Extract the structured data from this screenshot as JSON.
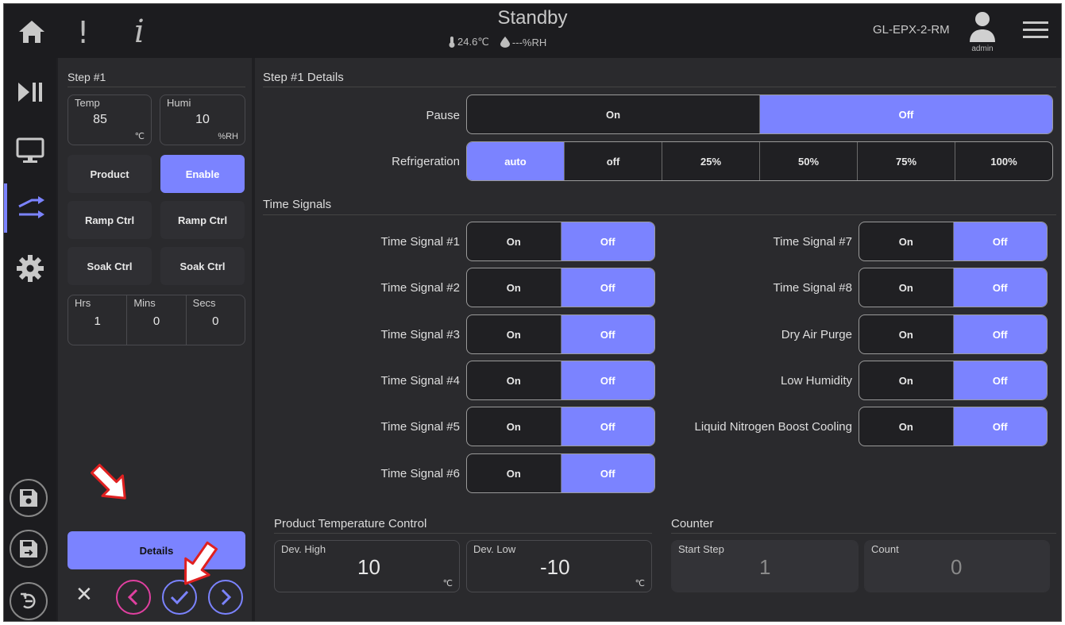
{
  "topbar": {
    "status": "Standby",
    "temperature": "24.6℃",
    "humidity": "---%RH",
    "machine": "GL-EPX-2-RM",
    "user": "admin",
    "alert_glyph": "!",
    "info_glyph": "i"
  },
  "step_panel": {
    "title": "Step #1",
    "temp": {
      "label": "Temp",
      "value": "85",
      "unit": "℃"
    },
    "humi": {
      "label": "Humi",
      "value": "10",
      "unit": "%RH"
    },
    "buttons": [
      {
        "label": "Product",
        "selected": false
      },
      {
        "label": "Enable",
        "selected": true
      },
      {
        "label": "Ramp Ctrl",
        "selected": false
      },
      {
        "label": "Ramp Ctrl",
        "selected": false
      },
      {
        "label": "Soak Ctrl",
        "selected": false
      },
      {
        "label": "Soak Ctrl",
        "selected": false
      }
    ],
    "time": [
      {
        "label": "Hrs",
        "value": "1"
      },
      {
        "label": "Mins",
        "value": "0"
      },
      {
        "label": "Secs",
        "value": "0"
      }
    ],
    "details_label": "Details",
    "cancel_glyph": "✕"
  },
  "details": {
    "title": "Step #1 Details",
    "pause": {
      "label": "Pause",
      "options": [
        "On",
        "Off"
      ],
      "selected": 1
    },
    "refrigeration": {
      "label": "Refrigeration",
      "options": [
        "auto",
        "off",
        "25%",
        "50%",
        "75%",
        "100%"
      ],
      "selected": 0
    }
  },
  "time_signals": {
    "title": "Time Signals",
    "left": [
      {
        "label": "Time Signal #1",
        "on": "On",
        "off": "Off",
        "selected": 1
      },
      {
        "label": "Time Signal #2",
        "on": "On",
        "off": "Off",
        "selected": 1
      },
      {
        "label": "Time Signal #3",
        "on": "On",
        "off": "Off",
        "selected": 1
      },
      {
        "label": "Time Signal #4",
        "on": "On",
        "off": "Off",
        "selected": 1
      },
      {
        "label": "Time Signal #5",
        "on": "On",
        "off": "Off",
        "selected": 1
      },
      {
        "label": "Time Signal #6",
        "on": "On",
        "off": "Off",
        "selected": 1
      }
    ],
    "right": [
      {
        "label": "Time Signal #7",
        "on": "On",
        "off": "Off",
        "selected": 1
      },
      {
        "label": "Time Signal #8",
        "on": "On",
        "off": "Off",
        "selected": 1
      },
      {
        "label": "Dry Air Purge",
        "on": "On",
        "off": "Off",
        "selected": 1
      },
      {
        "label": "Low Humidity",
        "on": "On",
        "off": "Off",
        "selected": 1
      },
      {
        "label": "Liquid Nitrogen Boost Cooling",
        "on": "On",
        "off": "Off",
        "selected": 1
      }
    ]
  },
  "product_temp": {
    "title": "Product Temperature Control",
    "dev_high": {
      "label": "Dev. High",
      "value": "10",
      "unit": "℃"
    },
    "dev_low": {
      "label": "Dev. Low",
      "value": "-10",
      "unit": "℃"
    }
  },
  "counter": {
    "title": "Counter",
    "start_step": {
      "label": "Start Step",
      "value": "1"
    },
    "count": {
      "label": "Count",
      "value": "0"
    }
  },
  "colors": {
    "accent": "#7b83ff",
    "prev": "#e040a0",
    "annotation": "#e02020"
  }
}
